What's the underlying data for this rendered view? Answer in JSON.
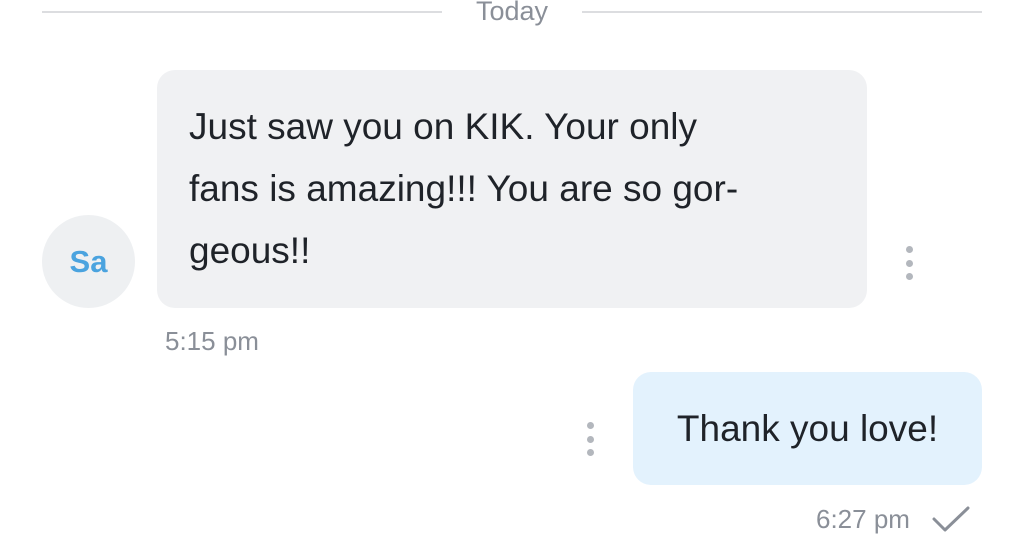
{
  "divider": {
    "label": "Today"
  },
  "messages": [
    {
      "direction": "incoming",
      "avatar_initials": "Sa",
      "text_lines": [
        "Just saw you on KIK. Your only",
        "fans is amazing!!! You are so gor-",
        "geous!!"
      ],
      "time": "5:15 pm"
    },
    {
      "direction": "outgoing",
      "text": "Thank you love!",
      "time": "6:27 pm",
      "status_icon": "check-icon"
    }
  ],
  "colors": {
    "incoming_bubble": "#f0f1f3",
    "outgoing_bubble": "#e3f2fd",
    "avatar_text": "#4aa3df",
    "timestamp": "#8a8f98"
  }
}
